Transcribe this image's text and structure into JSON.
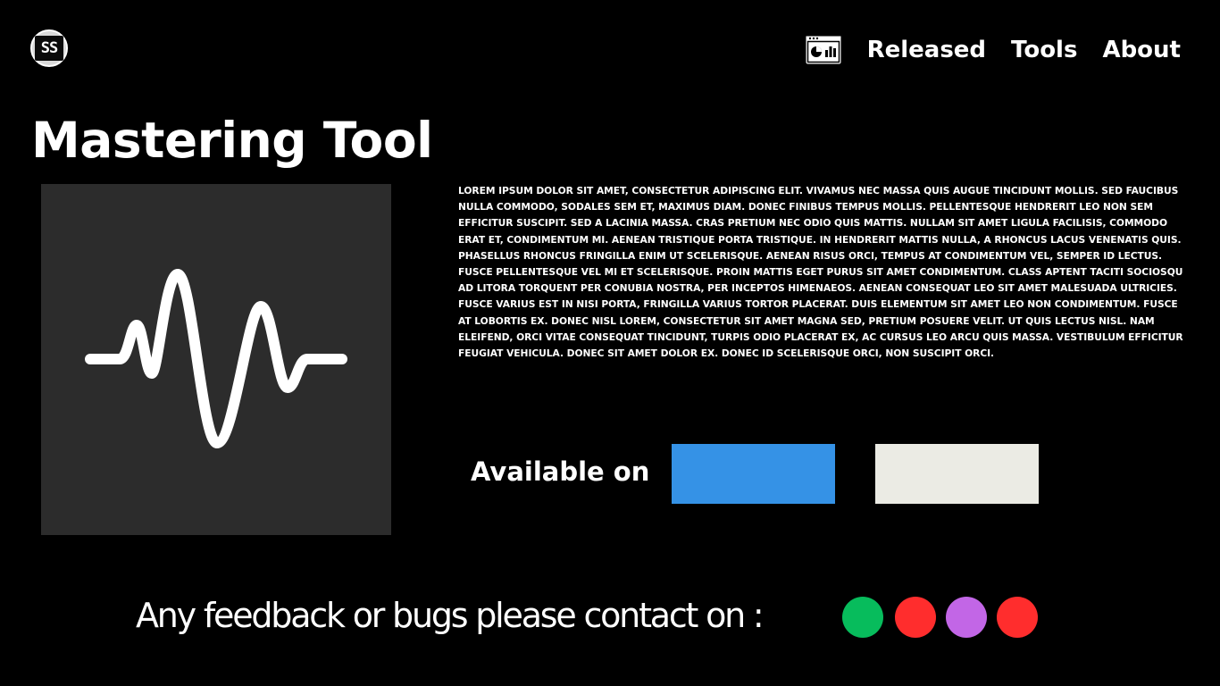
{
  "header": {
    "logo_text": "SS",
    "nav_icon": "dashboard-window-icon",
    "nav": [
      "Released",
      "Tools",
      "About"
    ]
  },
  "main": {
    "title": "Mastering Tool",
    "art_icon": "waveform-icon",
    "description": [
      "Lorem ipsum dolor sit amet, consectetur adipiscing elit. Vivamus nec massa quis augue tincidunt mollis. Sed faucibus nulla commodo, sodales sem et, maximus diam. Donec finibus tempus mollis. Pellentesque hendrerit leo non sem efficitur suscipit. Sed a lacinia massa. Cras pretium nec odio quis mattis. Nullam sit amet ligula facilisis, commodo erat et, condimentum mi. Aenean tristique porta tristique. In hendrerit mattis nulla, a rhoncus lacus venenatis quis.",
      "Phasellus rhoncus fringilla enim ut scelerisque. Aenean risus orci, tempus at condimentum vel, semper id lectus. Fusce pellentesque vel mi et scelerisque. Proin mattis eget purus sit amet condimentum. Class aptent taciti sociosqu ad litora torquent per conubia nostra, per inceptos himenaeos. Aenean consequat leo sit amet malesuada ultricies. Fusce varius est in nisi porta, fringilla varius tortor placerat. Duis elementum sit amet leo non condimentum. Fusce at lobortis ex. Donec nisl lorem, consectetur sit amet magna sed, pretium posuere velit. Ut quis lectus nisl. Nam eleifend, orci vitae consequat tincidunt, turpis odio placerat ex, ac cursus leo arcu quis massa. Vestibulum efficitur feugiat vehicula. Donec sit amet dolor ex. Donec id scelerisque orci, non suscipit orci."
    ],
    "available_label": "Available on",
    "store_buttons": [
      {
        "color": "#3592e6"
      },
      {
        "color": "#ebebe4"
      }
    ]
  },
  "footer": {
    "feedback_text": "Any feedback or bugs please contact on :",
    "contact_dots": [
      {
        "color": "#07bc5c"
      },
      {
        "color": "#ff2d2d"
      },
      {
        "color": "#c266e6"
      },
      {
        "color": "#ff2d2d"
      }
    ]
  },
  "colors": {
    "background": "#000000",
    "art_background": "#2c2c2c",
    "text": "#ffffff"
  }
}
